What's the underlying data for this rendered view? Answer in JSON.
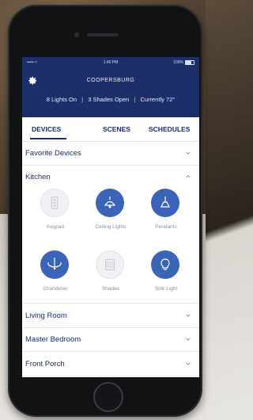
{
  "status_bar": {
    "signal": "••••• ≈",
    "time": "1:40 PM",
    "battery": "100%"
  },
  "header": {
    "home_name": "COOPERSBURG",
    "summary": {
      "lights": "8 Lights On",
      "shades": "3 Shades Open",
      "temp": "Currently 72°"
    }
  },
  "tabs": [
    {
      "label": "DEVICES",
      "active": true
    },
    {
      "label": "SCENES",
      "active": false
    },
    {
      "label": "SCHEDULES",
      "active": false
    }
  ],
  "sections": {
    "favorites": {
      "label": "Favorite Devices",
      "expanded": false
    },
    "kitchen": {
      "label": "Kitchen",
      "expanded": true
    },
    "living_room": {
      "label": "Living Room",
      "expanded": false
    },
    "master_bedroom": {
      "label": "Master Bedroom",
      "expanded": false
    },
    "front_porch": {
      "label": "Front Porch",
      "expanded": false
    }
  },
  "kitchen_devices": [
    {
      "label": "Keypad",
      "icon": "keypad-icon",
      "state": "off"
    },
    {
      "label": "Ceiling Lights",
      "icon": "ceiling-light-icon",
      "state": "on"
    },
    {
      "label": "Pendants",
      "icon": "pendant-icon",
      "state": "on"
    },
    {
      "label": "Chandelier",
      "icon": "chandelier-icon",
      "state": "on"
    },
    {
      "label": "Shades",
      "icon": "shade-icon",
      "state": "off"
    },
    {
      "label": "Sink Light",
      "icon": "bulb-icon",
      "state": "on"
    }
  ],
  "colors": {
    "header": "#1d2f6b",
    "accent": "#3b63b8",
    "text": "#1d2f6b",
    "muted": "#8a8fa0"
  }
}
